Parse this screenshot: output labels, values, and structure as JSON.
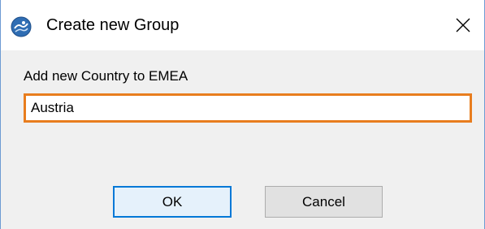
{
  "window": {
    "title": "Create new Group",
    "icon": "app-globe-icon",
    "close_icon": "close-icon"
  },
  "form": {
    "prompt": "Add new Country to EMEA",
    "input_value": "Austria",
    "input_focus_color": "#e87d1e"
  },
  "buttons": {
    "ok_label": "OK",
    "cancel_label": "Cancel"
  },
  "colors": {
    "accent": "#0078d7",
    "window_border": "#6d9bd3"
  }
}
